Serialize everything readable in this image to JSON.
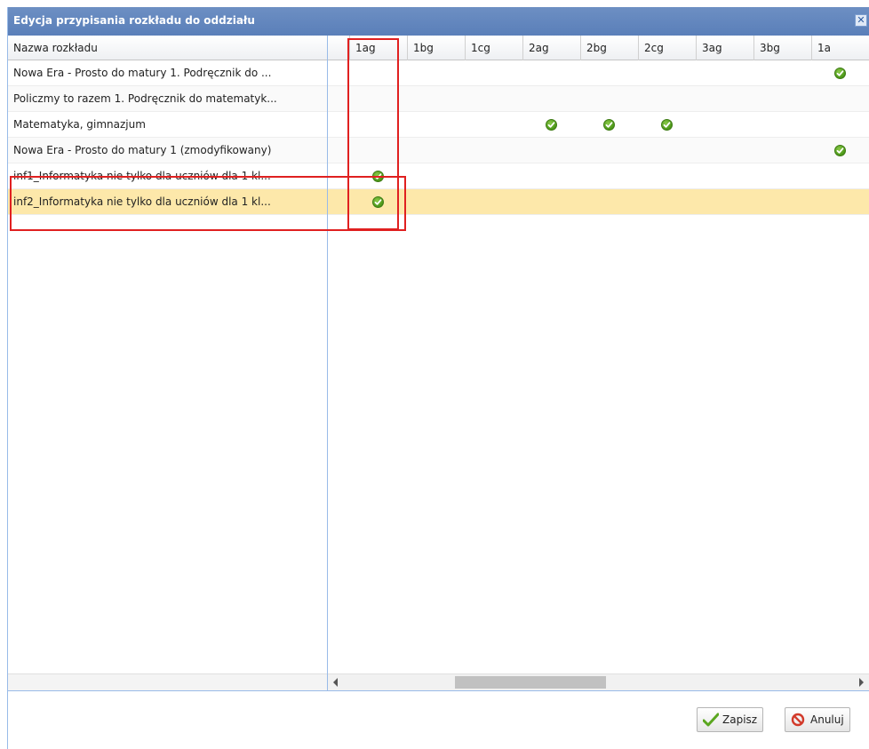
{
  "dialog": {
    "title": "Edycja przypisania rozkładu do oddziału",
    "close_icon": "close-icon"
  },
  "grid": {
    "name_header": "Nazwa rozkładu",
    "columns": [
      "1ag",
      "1bg",
      "1cg",
      "2ag",
      "2bg",
      "2cg",
      "3ag",
      "3bg",
      "1a"
    ],
    "rows": [
      {
        "name": "Nowa Era - Prosto do matury 1. Podręcznik do ...",
        "checks": [
          false,
          false,
          false,
          false,
          false,
          false,
          false,
          false,
          true
        ]
      },
      {
        "name": "Policzmy to razem 1. Podręcznik do matematyk...",
        "checks": [
          false,
          false,
          false,
          false,
          false,
          false,
          false,
          false,
          false
        ]
      },
      {
        "name": "Matematyka, gimnazjum",
        "checks": [
          false,
          false,
          false,
          true,
          true,
          true,
          false,
          false,
          false
        ]
      },
      {
        "name": "Nowa Era - Prosto do matury 1 (zmodyfikowany)",
        "checks": [
          false,
          false,
          false,
          false,
          false,
          false,
          false,
          false,
          true
        ]
      },
      {
        "name": "inf1_Informatyka nie tylko dla uczniów dla 1 kl...",
        "checks": [
          true,
          false,
          false,
          false,
          false,
          false,
          false,
          false,
          false
        ]
      },
      {
        "name": "inf2_Informatyka nie tylko dla uczniów dla 1 kl...",
        "checks": [
          true,
          false,
          false,
          false,
          false,
          false,
          false,
          false,
          false
        ],
        "selected": true
      }
    ],
    "scrollbar": {
      "thumb_position_fraction": 0.28
    }
  },
  "footer": {
    "save_label": "Zapisz",
    "cancel_label": "Anuluj",
    "save_icon": "checkmark-icon",
    "cancel_icon": "prohibited-icon"
  },
  "colors": {
    "titlebar": "#5a7fb9",
    "selected_row": "#fde8aa",
    "check_green": "#4a9617",
    "highlight_red": "#e02020"
  }
}
